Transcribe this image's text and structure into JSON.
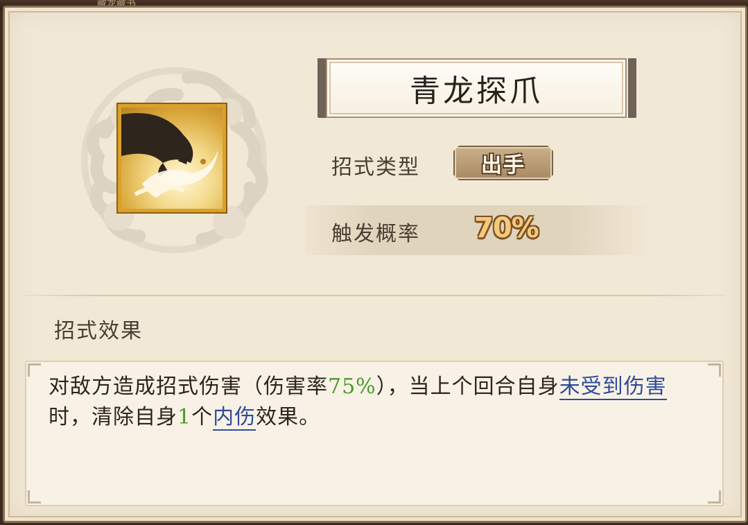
{
  "top_strip": {
    "text": "藏龙藏书"
  },
  "skill": {
    "name": "青龙探爪",
    "icon": "dragon-claw-icon",
    "type_label": "招式类型",
    "type_value": "出手",
    "trigger_label": "触发概率",
    "trigger_value": "70%"
  },
  "effect": {
    "heading": "招式效果",
    "segments": [
      {
        "text": "对敌方造成招式伤害（伤害率",
        "style": "plain"
      },
      {
        "text": "75%",
        "style": "green"
      },
      {
        "text": "），当上个回合自身",
        "style": "plain"
      },
      {
        "text": "未受到伤害",
        "style": "link"
      },
      {
        "text": "时，清除自身",
        "style": "plain"
      },
      {
        "text": "1",
        "style": "green"
      },
      {
        "text": "个",
        "style": "plain"
      },
      {
        "text": "内伤",
        "style": "link"
      },
      {
        "text": "效果。",
        "style": "plain"
      }
    ]
  },
  "colors": {
    "panel_bg": "#f1e8d6",
    "highlight_green": "#4a9a2c",
    "link_blue": "#2f4a9a",
    "icon_border_gold": "#d9a12b",
    "probability_gold": "#f6c97a"
  }
}
